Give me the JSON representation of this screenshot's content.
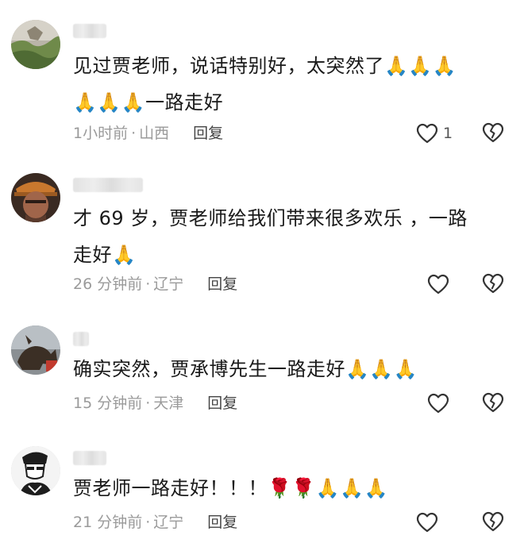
{
  "comments": [
    {
      "text": "见过贾老师，说话特别好，太突然了🙏🙏🙏\n🙏🙏🙏一路走好",
      "time": "1小时前",
      "location": "山西",
      "reply_label": "回复",
      "like_count": "1"
    },
    {
      "text": "才 69 岁，贾老师给我们带来很多欢乐 ，一路\n走好🙏",
      "time": "26 分钟前",
      "location": "辽宁",
      "reply_label": "回复",
      "like_count": ""
    },
    {
      "text": "确实突然，贾承博先生一路走好🙏🙏🙏",
      "time": "15 分钟前",
      "location": "天津",
      "reply_label": "回复",
      "like_count": ""
    },
    {
      "text": "贾老师一路走好！！！🌹🌹🙏🙏🙏",
      "time": "21 分钟前",
      "location": "辽宁",
      "reply_label": "回复",
      "like_count": ""
    }
  ],
  "icons": {
    "like": "heart-outline-icon",
    "dislike": "broken-heart-icon"
  },
  "colors": {
    "text": "#1a1a1a",
    "meta": "#9a9a9a",
    "reply": "#444444"
  }
}
